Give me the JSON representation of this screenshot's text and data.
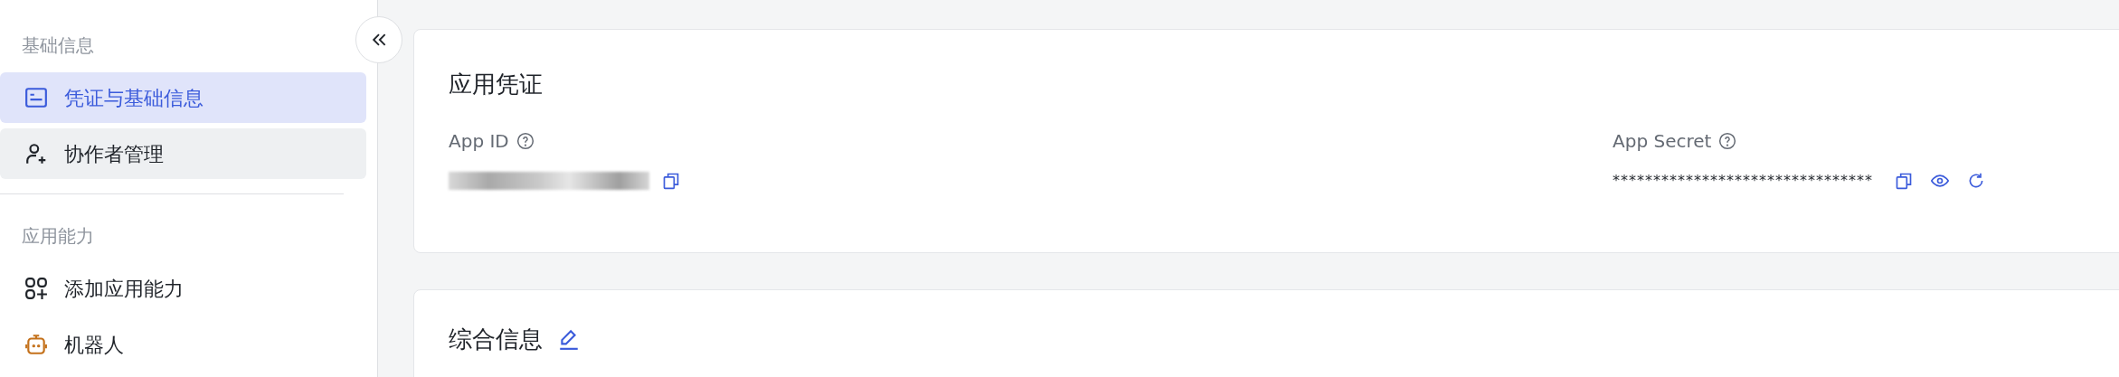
{
  "sidebar": {
    "sections": [
      {
        "title": "基础信息",
        "items": [
          {
            "label": "凭证与基础信息",
            "selected": true,
            "hovered": false
          },
          {
            "label": "协作者管理",
            "selected": false,
            "hovered": true
          }
        ]
      },
      {
        "title": "应用能力",
        "items": [
          {
            "label": "添加应用能力",
            "selected": false,
            "hovered": false
          },
          {
            "label": "机器人",
            "selected": false,
            "hovered": false
          }
        ]
      }
    ]
  },
  "credentials_card": {
    "title": "应用凭证",
    "fields": [
      {
        "label": "App ID",
        "kind": "blurred"
      },
      {
        "label": "App Secret",
        "kind": "masked",
        "value": "********************************"
      }
    ]
  },
  "info_card": {
    "title": "综合信息",
    "editable": true
  }
}
